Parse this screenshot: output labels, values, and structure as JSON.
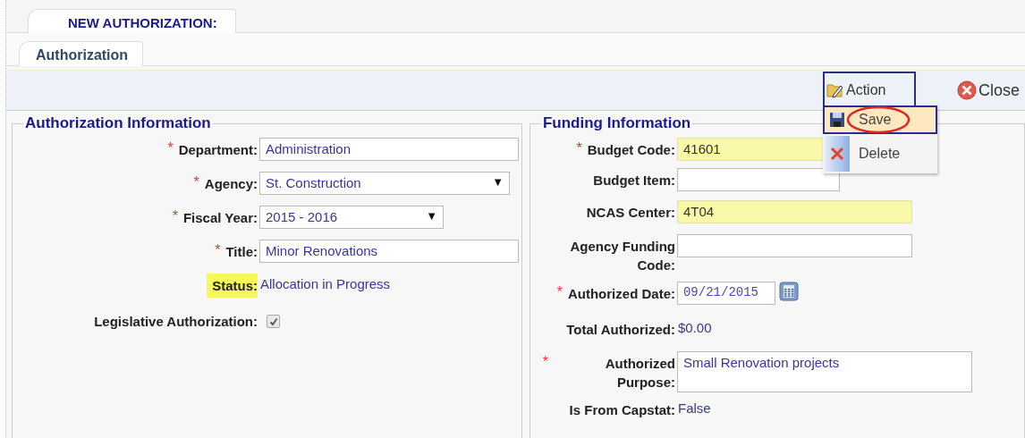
{
  "tabs_top": [
    {
      "label": "NEW AUTHORIZATION:",
      "selected": true
    }
  ],
  "tabs_sub": [
    {
      "label": "Authorization",
      "selected": true
    }
  ],
  "toolbar": {
    "action_button": "Action",
    "close_button": "Close"
  },
  "action_menu": {
    "items": [
      {
        "label": "Save",
        "kind": "save",
        "selected": true,
        "circled": true
      },
      {
        "label": "Delete",
        "kind": "delete",
        "selected": false,
        "circled": false
      }
    ]
  },
  "sections": [
    {
      "legend": "Authorization Information",
      "fields": [
        {
          "marker": "*",
          "label": "Department:",
          "kind": "text",
          "value": "Administration",
          "highlighted": false,
          "label_highlighted": false
        },
        {
          "marker": "*",
          "label": "Agency:",
          "kind": "select",
          "value": "St. Construction",
          "caret": "▼",
          "highlighted": false,
          "label_highlighted": false
        },
        {
          "marker": "*",
          "label": "Fiscal Year:",
          "kind": "select",
          "value": "2015 - 2016",
          "caret": "▼",
          "highlighted": false,
          "label_highlighted": false
        },
        {
          "marker": "*",
          "label": "Title:",
          "kind": "text",
          "value": "Minor Renovations",
          "highlighted": false,
          "label_highlighted": false
        },
        {
          "label": "Status:",
          "kind": "display",
          "value": "Allocation in Progress",
          "label_highlighted": true
        },
        {
          "label": "Legislative Authorization:",
          "kind": "checkbox",
          "checked": true,
          "label_highlighted": false
        }
      ]
    },
    {
      "legend": "Funding Information",
      "fields": [
        {
          "marker": "*",
          "label": "Budget Code:",
          "kind": "text",
          "value": "41601",
          "highlighted": true,
          "label_highlighted": false
        },
        {
          "label": "Budget Item:",
          "kind": "text",
          "highlighted": false,
          "label_highlighted": false
        },
        {
          "label": "NCAS Center:",
          "kind": "text",
          "value": "4T04",
          "highlighted": true,
          "label_highlighted": false
        },
        {
          "label": "Agency Funding Code:",
          "kind": "text",
          "highlighted": false,
          "label_highlighted": false
        },
        {
          "marker": "*",
          "label": "Authorized Date:",
          "kind": "date",
          "value": "09/21/2015",
          "highlighted": false,
          "label_highlighted": false
        },
        {
          "label": "Total Authorized:",
          "kind": "display",
          "value": "$0.00",
          "label_highlighted": false
        },
        {
          "marker": "*",
          "label": "Authorized Purpose:",
          "kind": "textarea",
          "value": "Small Renovation projects",
          "highlighted": false,
          "label_highlighted": false
        },
        {
          "label": "Is From Capstat:",
          "kind": "display",
          "value": "False",
          "label_highlighted": false
        }
      ]
    }
  ]
}
